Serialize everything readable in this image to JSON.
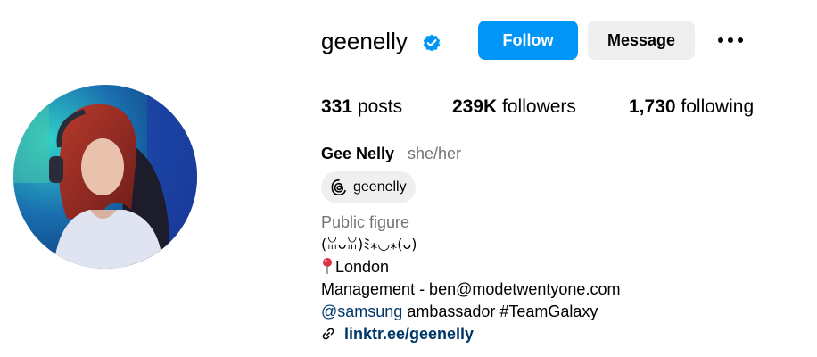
{
  "profile": {
    "username": "geenelly",
    "verified": true,
    "full_name": "Gee Nelly",
    "pronouns": "she/her",
    "category": "Public figure"
  },
  "actions": {
    "follow_label": "Follow",
    "message_label": "Message",
    "more_icon": "more-horizontal-icon"
  },
  "stats": {
    "posts_count": "331",
    "posts_label": "posts",
    "followers_count": "239K",
    "followers_label": "followers",
    "following_count": "1,730",
    "following_label": "following"
  },
  "threads": {
    "icon": "threads-icon",
    "handle": "geenelly"
  },
  "bio": {
    "kaomoji": "(ꈍᴗꈍ)ﾐ⁎◡⁎(ᴗ)",
    "location_icon": "round-pushpin-icon",
    "location": "London",
    "management": "Management - ben@modetwentyone.com",
    "mention": "@samsung",
    "ambassador_rest": " ambassador #TeamGalaxy",
    "link_icon": "link-icon",
    "link": "linktr.ee/geenelly"
  },
  "colors": {
    "follow_bg": "#0095f6",
    "message_bg": "#efefef",
    "verified": "#0095f6",
    "link": "#00376b",
    "muted": "#737373"
  }
}
